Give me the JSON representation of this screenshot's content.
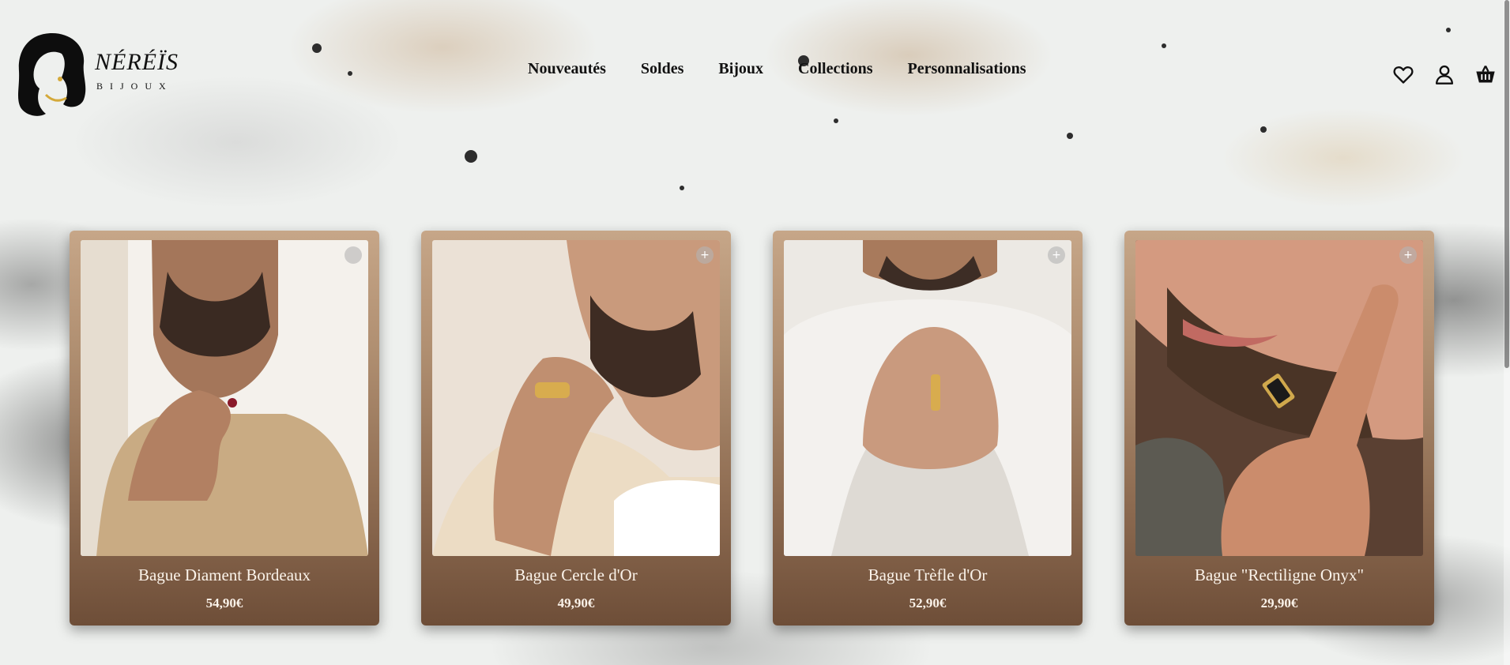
{
  "brand": {
    "name": "NÉRÉÏS",
    "tagline": "BIJOUX"
  },
  "nav": {
    "items": [
      {
        "label": "Nouveautés"
      },
      {
        "label": "Soldes"
      },
      {
        "label": "Bijoux"
      },
      {
        "label": "Collections"
      },
      {
        "label": "Personnalisations"
      }
    ]
  },
  "header_icons": [
    "heart-icon",
    "user-icon",
    "cart-icon"
  ],
  "products": [
    {
      "title": "Bague Diament Bordeaux",
      "price": "54,90€",
      "add": ""
    },
    {
      "title": "Bague Cercle d'Or",
      "price": "49,90€",
      "add": "+"
    },
    {
      "title": "Bague Trèfle d'Or",
      "price": "52,90€",
      "add": "+"
    },
    {
      "title": "Bague \"Rectiligne Onyx\"",
      "price": "29,90€",
      "add": "+"
    }
  ],
  "colors": {
    "card_top": "#c6a688",
    "card_bottom": "#6e4e38",
    "text_light": "#fbf3ea"
  }
}
